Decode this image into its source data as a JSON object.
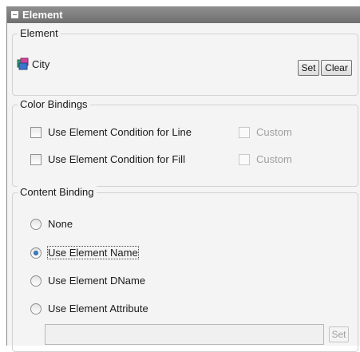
{
  "panel": {
    "title": "Element"
  },
  "element_group": {
    "legend": "Element",
    "element_name": "City",
    "element_icon": "element-city-icon",
    "set_label": "Set",
    "clear_label": "Clear"
  },
  "color_bindings": {
    "legend": "Color Bindings",
    "line_label": "Use Element Condition for Line",
    "line_checked": false,
    "line_custom_label": "Custom",
    "fill_label": "Use Element Condition for Fill",
    "fill_checked": false,
    "fill_custom_label": "Custom"
  },
  "content_binding": {
    "legend": "Content Binding",
    "options": [
      {
        "label": "None",
        "checked": false
      },
      {
        "label": "Use Element Name",
        "checked": true
      },
      {
        "label": "Use Element DName",
        "checked": false
      },
      {
        "label": "Use Element Attribute",
        "checked": false
      }
    ],
    "attribute_value": "",
    "attribute_set_label": "Set"
  }
}
